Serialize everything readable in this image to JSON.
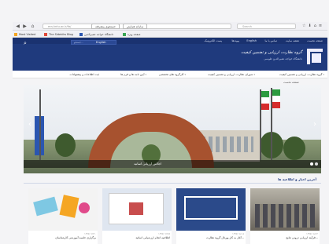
{
  "browser": {
    "url": "ecs.kntu.ac.ir/fa/",
    "search_placeholder": "Search",
    "tab_label": "سامانه همایش",
    "tab2_label": "جستجوی پیشرفته",
    "bookmarks": [
      "Most Visited",
      "The Sidekiks Blog",
      "دانشگاه خواجه نصیرالدین",
      "صفحه ویژه"
    ]
  },
  "site": {
    "toplinks": [
      "صفحه نخست",
      "نقشه سایت",
      "تماس با ما",
      "English",
      "پیوندها",
      "پست الکترونیک"
    ],
    "search_placeholder": "جستجو...",
    "lang": "English",
    "logo_title": "گروه نظارت، ارزیابی و تضمین کیفیت",
    "logo_subtitle": "دانشگاه خواجه نصیرالدین طوسی"
  },
  "nav": {
    "items": [
      "گروه نظارت، ارزیابی و تضمین کیفیت",
      "شورای نظارت، ارزیابی و تضمین کیفیت",
      "کارگروه های تخصصی",
      "آیین نامه ها و فرم ها",
      "ثبت اطلاعات و پیشنهادات"
    ]
  },
  "breadcrumb": "صفحه نخست",
  "hero": {
    "caption": "اجلاس ارزیابی اساتید",
    "slide_count": 2,
    "active_slide": 1
  },
  "news": {
    "section_title": "آخرین اخبار و اطلاعیه ها",
    "cards": [
      {
        "date": "۱۳۹۷/۰۸/۱۲",
        "title": "فرآیند ارزیابی درونی نتایج..."
      },
      {
        "date": "۱۳۹۷/۰۸/۰۵",
        "title": "آغاز به کار پورتال گروه نظارت..."
      },
      {
        "date": "۱۳۹۷/۰۷/۲۸",
        "title": "اطلاعیه انجام ارزشیابی اساتید"
      },
      {
        "date": "۱۳۹۷/۰۷/۲۰",
        "title": "برگزاری جلسه آموزشی کارشناسان"
      }
    ]
  },
  "colors": {
    "header_blue": "#1f3a7d",
    "accent": "#2b56b0"
  }
}
